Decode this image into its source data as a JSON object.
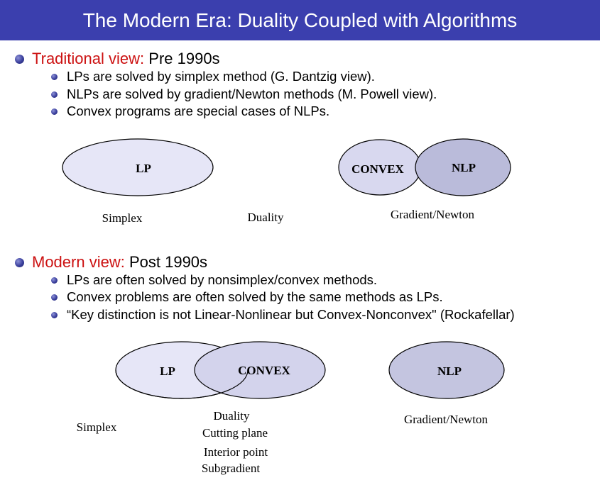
{
  "header": {
    "title": "The Modern Era: Duality Coupled with Algorithms",
    "accent_color": "#3b3fae"
  },
  "traditional": {
    "label": "Traditional view:",
    "period": "Pre 1990s",
    "points": [
      "LPs are solved by simplex method (G. Dantzig view).",
      "NLPs are solved by gradient/Newton methods (M. Powell view).",
      "Convex programs are special cases of NLPs."
    ],
    "diagram": {
      "lp": "LP",
      "convex": "CONVEX",
      "nlp": "NLP",
      "simplex": "Simplex",
      "duality": "Duality",
      "gradient": "Gradient/Newton"
    }
  },
  "modern": {
    "label": "Modern view:",
    "period": "Post 1990s",
    "points": [
      "LPs are often solved by nonsimplex/convex methods.",
      "Convex problems are often solved by the same methods as LPs.",
      "“Key distinction is not Linear-Nonlinear but Convex-Nonconvex\" (Rockafellar)"
    ],
    "diagram": {
      "lp": "LP",
      "convex": "CONVEX",
      "nlp": "NLP",
      "simplex": "Simplex",
      "methods": [
        "Duality",
        "Cutting plane",
        "Interior point",
        "Subgradient"
      ],
      "gradient": "Gradient/Newton"
    }
  },
  "colors": {
    "label_red": "#cc1111",
    "ellipse_light": "#e6e6f7",
    "ellipse_mid": "#d3d3ec",
    "ellipse_dark": "#b8b9d8"
  }
}
